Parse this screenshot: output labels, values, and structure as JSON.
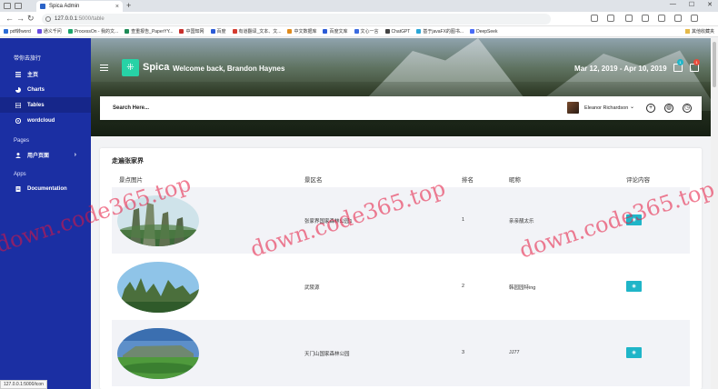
{
  "browser": {
    "tab_title": "Spica Admin",
    "tab_close": "×",
    "new_tab": "+",
    "url_host": "127.0.0.1",
    "url_rest": ":5000/table",
    "bookmarks": [
      {
        "label": "pdf转word",
        "color": "#2b6cd6"
      },
      {
        "label": "通义千问",
        "color": "#6a4be0"
      },
      {
        "label": "ProcessOn - 我的文...",
        "color": "#1ba36a"
      },
      {
        "label": "查重报告_PaperYY...",
        "color": "#1e8b57"
      },
      {
        "label": "中国知网",
        "color": "#c8302c"
      },
      {
        "label": "百度",
        "color": "#2b5bd6"
      },
      {
        "label": "有道翻译_文本、文...",
        "color": "#d43b2f"
      },
      {
        "label": "中文数据库",
        "color": "#e08b1d"
      },
      {
        "label": "百度文库",
        "color": "#2b5bd6"
      },
      {
        "label": "文心一言",
        "color": "#3b6be0"
      },
      {
        "label": "ChatGPT",
        "color": "#444444"
      },
      {
        "label": "基于javaFX的图书...",
        "color": "#2aa7d8"
      },
      {
        "label": "DeepSeek",
        "color": "#4a6cf7"
      }
    ],
    "other_bookmarks": "其他收藏夹",
    "status_url": "127.0.0.1:5000/icon"
  },
  "sidebar": {
    "brand": "带你去旅行",
    "items": [
      {
        "label": "主页",
        "icon": "list-icon"
      },
      {
        "label": "Charts",
        "icon": "pie-chart-icon"
      },
      {
        "label": "Tables",
        "icon": "table-icon"
      },
      {
        "label": "wordcloud",
        "icon": "cloud-icon"
      }
    ],
    "section_pages": "Pages",
    "pages_items": [
      {
        "label": "用户页面",
        "icon": "user-icon",
        "chevron": "›"
      }
    ],
    "section_apps": "Apps",
    "apps_items": [
      {
        "label": "Documentation",
        "icon": "doc-icon"
      }
    ]
  },
  "header": {
    "logo_text": "Spica",
    "logo_glyph": "⁜",
    "welcome": "Welcome back, Brandon Haynes",
    "date_range": "Mar 12, 2019 - Apr 10, 2019",
    "badge_messages": "1",
    "badge_cart": "1",
    "colors": {
      "sidebar": "#1b2fa3",
      "logo": "#27d2a6",
      "badge_blue": "#1fb5c8",
      "badge_red": "#e74c3c"
    }
  },
  "search": {
    "placeholder": "Search Here...",
    "user_name": "Eleanor Richardson",
    "caret": "⌄",
    "icons": [
      "plus-circle-icon",
      "globe-icon",
      "clock-icon"
    ]
  },
  "table": {
    "title": "走遍张家界",
    "headers": [
      "景点图片",
      "景区名",
      "排名",
      "昵称",
      "评论内容"
    ],
    "rows": [
      {
        "name": "张家界国家森林公园1",
        "rank": "1",
        "nickname": "亲亲靓太乐",
        "action_icon": "eye-icon"
      },
      {
        "name": "武陵源",
        "rank": "2",
        "nickname": "韩园园特ing",
        "action_icon": "eye-icon"
      },
      {
        "name": "天门山国家森林公园",
        "rank": "3",
        "nickname": "JJ77",
        "action_icon": "eye-icon"
      }
    ]
  },
  "watermark": "down.code365.top"
}
